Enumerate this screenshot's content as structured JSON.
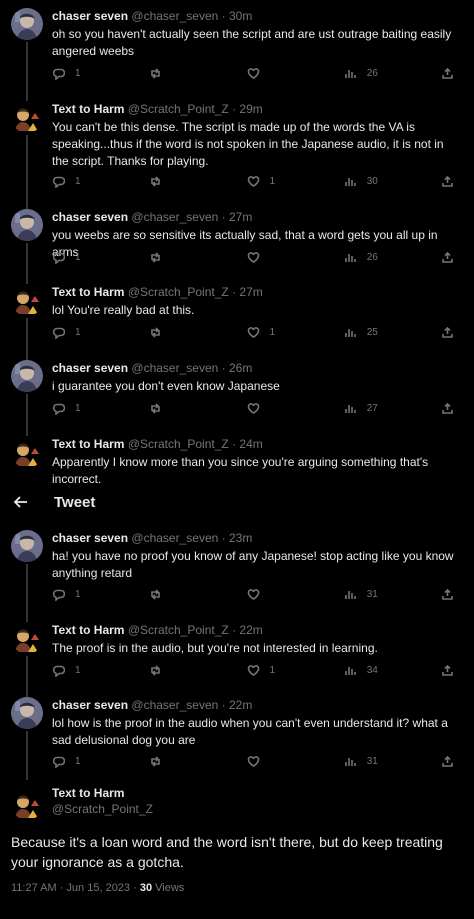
{
  "header": {
    "title": "Tweet"
  },
  "users": {
    "chaser": {
      "name": "chaser seven",
      "handle": "@chaser_seven"
    },
    "harm": {
      "name": "Text to Harm",
      "handle": "@Scratch_Point_Z"
    }
  },
  "top_replies": [
    {
      "user": "chaser",
      "name": "chaser seven",
      "handle": "@chaser_seven",
      "dot": "·",
      "time": "30m",
      "text": "oh so you haven't actually seen the script and are ust outrage baiting easily angered weebs",
      "replies": "1",
      "retweets": "",
      "likes": "",
      "views": "26"
    },
    {
      "user": "harm",
      "name": "Text to Harm",
      "handle": "@Scratch_Point_Z",
      "dot": "·",
      "time": "29m",
      "text": "You can't be this dense. The script is made up of the words the VA is speaking...thus if the word is not spoken in the Japanese audio, it is not in the script. Thanks for playing.",
      "replies": "1",
      "retweets": "",
      "likes": "1",
      "views": "30"
    },
    {
      "user": "chaser",
      "name": "chaser seven",
      "handle": "@chaser_seven",
      "dot": "·",
      "time": "27m",
      "text": "you weebs are so sensitive its actually sad, that a word gets you all up in arms",
      "replies": "1",
      "retweets": "",
      "likes": "",
      "views": "26"
    },
    {
      "user": "harm",
      "name": "Text to Harm",
      "handle": "@Scratch_Point_Z",
      "dot": "·",
      "time": "27m",
      "text": "lol You're really bad at this.",
      "replies": "1",
      "retweets": "",
      "likes": "1",
      "views": "25"
    },
    {
      "user": "chaser",
      "name": "chaser seven",
      "handle": "@chaser_seven",
      "dot": "·",
      "time": "26m",
      "text": "i guarantee you don't even know Japanese",
      "replies": "1",
      "retweets": "",
      "likes": "",
      "views": "27"
    },
    {
      "user": "harm",
      "name": "Text to Harm",
      "handle": "@Scratch_Point_Z",
      "dot": "·",
      "time": "24m",
      "text": "Apparently I know more than you since you're arguing something that's incorrect."
    }
  ],
  "bottom_replies": [
    {
      "user": "chaser",
      "name": "chaser seven",
      "handle": "@chaser_seven",
      "dot": "·",
      "time": "23m",
      "text": "ha! you have no proof you know of any Japanese! stop acting like you know anything retard",
      "replies": "1",
      "retweets": "",
      "likes": "",
      "views": "31"
    },
    {
      "user": "harm",
      "name": "Text to Harm",
      "handle": "@Scratch_Point_Z",
      "dot": "·",
      "time": "22m",
      "text": "The proof is in the audio, but you're not interested in learning.",
      "replies": "1",
      "retweets": "",
      "likes": "1",
      "views": "34"
    },
    {
      "user": "chaser",
      "name": "chaser seven",
      "handle": "@chaser_seven",
      "dot": "·",
      "time": "22m",
      "text": "lol how is the proof in the audio when you can't even understand it? what a sad delusional dog you are",
      "replies": "1",
      "retweets": "",
      "likes": "",
      "views": "31"
    }
  ],
  "main_tweet": {
    "name": "Text to Harm",
    "handle": "@Scratch_Point_Z",
    "text": "Because it's a loan word and the word isn't there, but do keep treating your ignorance as a gotcha.",
    "timestamp": "11:27 AM · Jun 15, 2023 · ",
    "views_count": "30",
    "views_label": " Views"
  },
  "colors": {
    "background": "#000000",
    "text": "#e7e9ea",
    "muted": "#71767b",
    "divider": "#2f3336"
  },
  "icons": [
    "reply-icon",
    "retweet-icon",
    "like-icon",
    "views-icon",
    "share-icon",
    "back-arrow-icon"
  ]
}
